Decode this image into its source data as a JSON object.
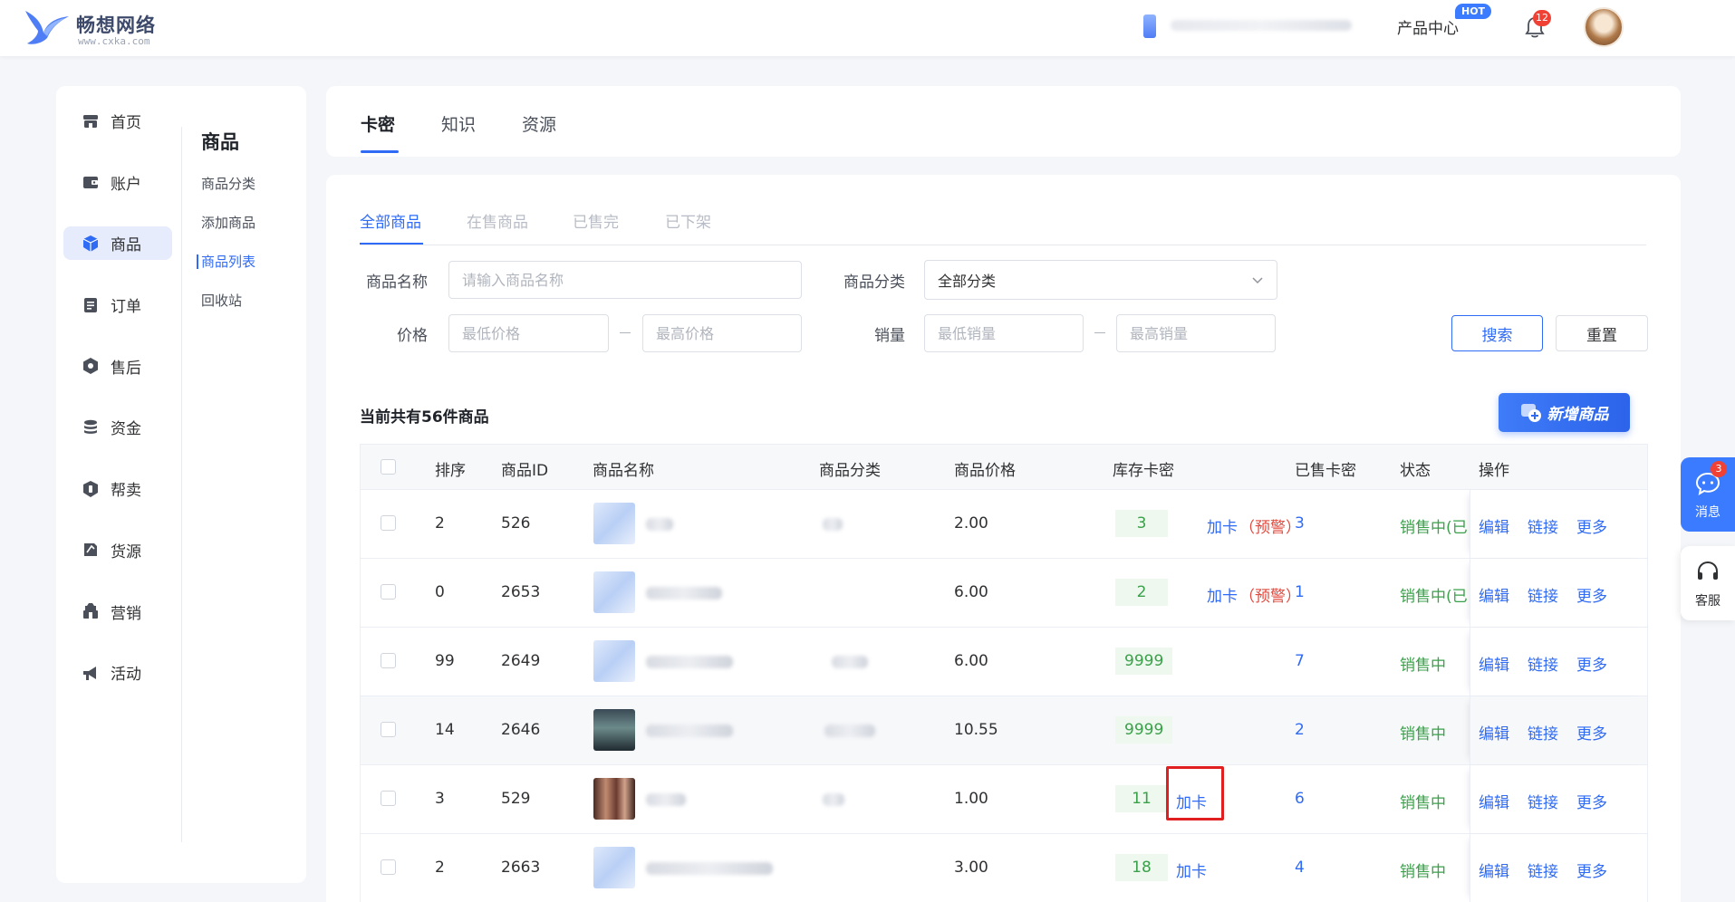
{
  "header": {
    "logo_title": "畅想网络",
    "logo_sub": "www.cxka.com",
    "product_center": "产品中心",
    "hot_badge": "HOT",
    "notification_count": "12"
  },
  "sidebar": {
    "items": [
      {
        "label": "首页",
        "icon": "store-icon"
      },
      {
        "label": "账户",
        "icon": "wallet-icon"
      },
      {
        "label": "商品",
        "icon": "cube-icon"
      },
      {
        "label": "订单",
        "icon": "order-icon"
      },
      {
        "label": "售后",
        "icon": "hexagon-icon"
      },
      {
        "label": "资金",
        "icon": "coins-icon"
      },
      {
        "label": "帮卖",
        "icon": "shield-icon"
      },
      {
        "label": "货源",
        "icon": "source-icon"
      },
      {
        "label": "营销",
        "icon": "marketing-icon"
      },
      {
        "label": "活动",
        "icon": "megaphone-icon"
      }
    ],
    "submenu_title": "商品",
    "submenu": [
      "商品分类",
      "添加商品",
      "商品列表",
      "回收站"
    ]
  },
  "top_tabs": [
    "卡密",
    "知识",
    "资源"
  ],
  "sub_tabs": [
    "全部商品",
    "在售商品",
    "已售完",
    "已下架"
  ],
  "filters": {
    "name_label": "商品名称",
    "name_placeholder": "请输入商品名称",
    "category_label": "商品分类",
    "category_value": "全部分类",
    "price_label": "价格",
    "price_min_placeholder": "最低价格",
    "price_max_placeholder": "最高价格",
    "sales_label": "销量",
    "sales_min_placeholder": "最低销量",
    "sales_max_placeholder": "最高销量",
    "search_button": "搜索",
    "reset_button": "重置"
  },
  "summary": {
    "count_text": "当前共有56件商品",
    "add_button": "新增商品"
  },
  "table": {
    "headers": [
      "排序",
      "商品ID",
      "商品名称",
      "商品分类",
      "商品价格",
      "库存卡密",
      "已售卡密",
      "状态",
      "操作"
    ],
    "rows": [
      {
        "sort": "2",
        "id": "526",
        "price": "2.00",
        "stock": "3",
        "add_card": "加卡",
        "warning": "（预警）",
        "sold": "3",
        "status": "销售中(已",
        "ops": [
          "编辑",
          "链接",
          "更多"
        ]
      },
      {
        "sort": "0",
        "id": "2653",
        "price": "6.00",
        "stock": "2",
        "add_card": "加卡",
        "warning": "（预警）",
        "sold": "1",
        "status": "销售中(已",
        "ops": [
          "编辑",
          "链接",
          "更多"
        ]
      },
      {
        "sort": "99",
        "id": "2649",
        "price": "6.00",
        "stock": "9999",
        "add_card": "",
        "warning": "",
        "sold": "7",
        "status": "销售中",
        "ops": [
          "编辑",
          "链接",
          "更多"
        ]
      },
      {
        "sort": "14",
        "id": "2646",
        "price": "10.55",
        "stock": "9999",
        "add_card": "",
        "warning": "",
        "sold": "2",
        "status": "销售中",
        "ops": [
          "编辑",
          "链接",
          "更多"
        ]
      },
      {
        "sort": "3",
        "id": "529",
        "price": "1.00",
        "stock": "11",
        "add_card": "加卡",
        "warning": "",
        "sold": "6",
        "status": "销售中",
        "ops": [
          "编辑",
          "链接",
          "更多"
        ]
      },
      {
        "sort": "2",
        "id": "2663",
        "price": "3.00",
        "stock": "18",
        "add_card": "加卡",
        "warning": "",
        "sold": "4",
        "status": "销售中",
        "ops": [
          "编辑",
          "链接",
          "更多"
        ]
      }
    ]
  },
  "float": {
    "message_label": "消息",
    "message_count": "3",
    "service_label": "客服"
  },
  "colors": {
    "primary": "#2f6bf5",
    "success": "#3aa14a",
    "danger": "#e2483d",
    "badge": "#f04134"
  }
}
